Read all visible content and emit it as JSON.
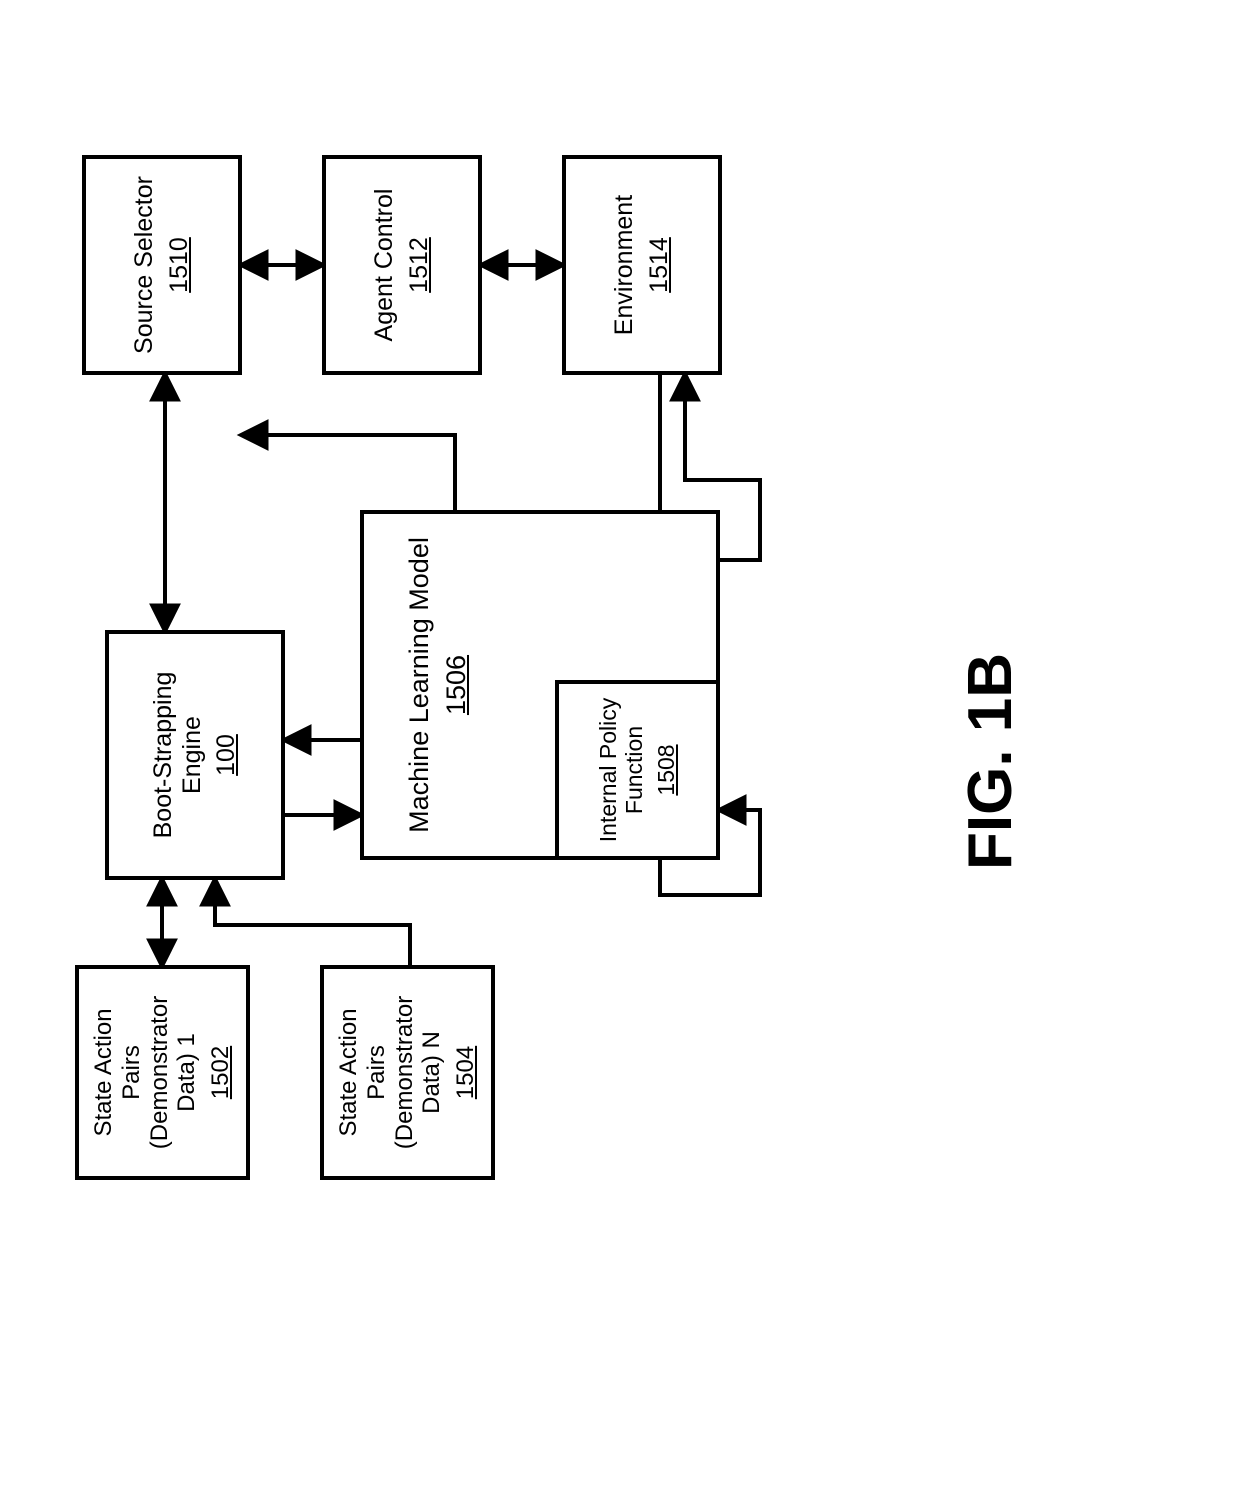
{
  "figure_label": "FIG. 1B",
  "boxes": {
    "sap1": {
      "title": "State Action Pairs (Demonstrator Data) 1",
      "ref": "1502"
    },
    "sapN": {
      "title": "State Action Pairs (Demonstrator Data) N",
      "ref": "1504"
    },
    "boot": {
      "title": "Boot-Strapping Engine",
      "ref": "100"
    },
    "mlm": {
      "title": "Machine Learning Model",
      "ref": "1506"
    },
    "ipf": {
      "title": "Internal Policy Function",
      "ref": "1508"
    },
    "src": {
      "title": "Source Selector",
      "ref": "1510"
    },
    "agent": {
      "title": "Agent Control",
      "ref": "1512"
    },
    "env": {
      "title": "Environment",
      "ref": "1514"
    }
  }
}
